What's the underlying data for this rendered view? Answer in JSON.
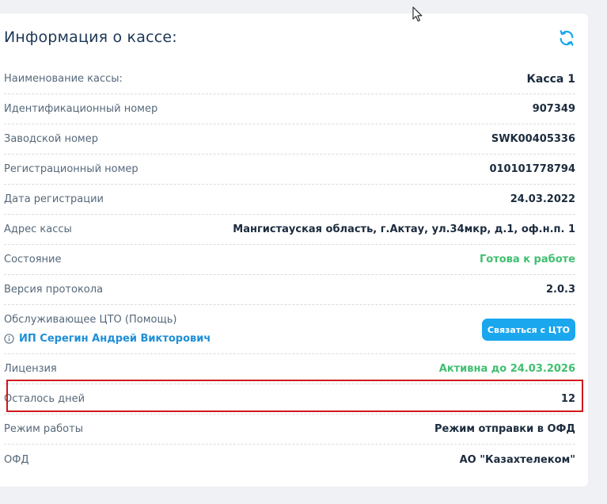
{
  "panel": {
    "title": "Информация о кассе:",
    "refresh_icon": "refresh-icon"
  },
  "rows": [
    {
      "label": "Наименование кассы:",
      "value": "Касса 1"
    },
    {
      "label": "Идентификационный номер",
      "value": "907349"
    },
    {
      "label": "Заводской номер",
      "value": "SWK00405336"
    },
    {
      "label": "Регистрационный номер",
      "value": "010101778794"
    },
    {
      "label": "Дата регистрации",
      "value": "24.03.2022"
    },
    {
      "label": "Адрес кассы",
      "value": "Мангистауская область, г.Актау, ул.34мкр, д.1, оф.н.п. 1"
    },
    {
      "label": "Состояние",
      "value": "Готова к работе"
    },
    {
      "label": "Версия протокола",
      "value": "2.0.3"
    }
  ],
  "cto": {
    "label": "Обслуживающее ЦТО (Помощь)",
    "name": "ИП Серегин Андрей Викторович",
    "button_label": "Связаться с ЦТО",
    "info_icon": "info-icon"
  },
  "rows2": [
    {
      "label": "Лицензия",
      "value": "Активна до 24.03.2026"
    },
    {
      "label": "Осталось дней",
      "value": "12"
    },
    {
      "label": "Режим работы",
      "value": "Режим отправки в ОФД"
    },
    {
      "label": "ОФД",
      "value": "АО \"Казахтелеком\""
    }
  ],
  "colors": {
    "accent": "#1aa7ee",
    "status_green": "#3fbf6f",
    "highlight_red": "#d0161d",
    "title": "#1d3756"
  }
}
